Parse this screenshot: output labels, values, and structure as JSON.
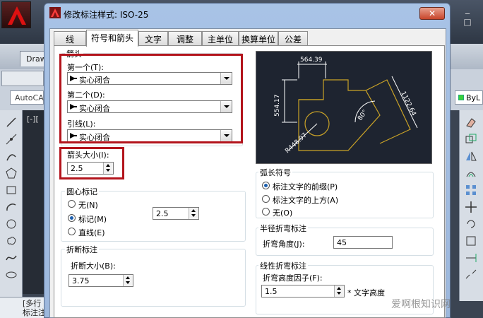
{
  "app": {
    "drawing_tab": "Draw",
    "left_combo": "AutoCA",
    "canvas_label": "[-][",
    "bylayer": "ByL",
    "command_lines": [
      "[多行",
      "标注注"
    ]
  },
  "dialog": {
    "title": "修改标注样式: ISO-25",
    "close_label": "✕"
  },
  "tabs": [
    {
      "label": "线",
      "active": false
    },
    {
      "label": "符号和箭头",
      "active": true
    },
    {
      "label": "文字",
      "active": false
    },
    {
      "label": "调整",
      "active": false
    },
    {
      "label": "主单位",
      "active": false
    },
    {
      "label": "换算单位",
      "active": false
    },
    {
      "label": "公差",
      "active": false
    }
  ],
  "arrows": {
    "group_label": "箭头",
    "first_label": "第一个(T):",
    "first_value": "实心闭合",
    "second_label": "第二个(D):",
    "second_value": "实心闭合",
    "leader_label": "引线(L):",
    "leader_value": "实心闭合",
    "size_label": "箭头大小(I):",
    "size_value": "2.5"
  },
  "center_mark": {
    "group_label": "圆心标记",
    "options": [
      "无(N)",
      "标记(M)",
      "直线(E)"
    ],
    "selected": 1,
    "size_value": "2.5"
  },
  "break": {
    "group_label": "折断标注",
    "size_label": "折断大小(B):",
    "size_value": "3.75"
  },
  "arc_length": {
    "group_label": "弧长符号",
    "options": [
      "标注文字的前缀(P)",
      "标注文字的上方(A)",
      "无(O)"
    ],
    "selected": 0
  },
  "radius_jog": {
    "group_label": "半径折弯标注",
    "angle_label": "折弯角度(J):",
    "angle_value": "45"
  },
  "linear_jog": {
    "group_label": "线性折弯标注",
    "factor_label": "折弯高度因子(F):",
    "factor_value": "1.5",
    "suffix": "* 文字高度"
  },
  "preview": {
    "dim_top": "564.39",
    "dim_left": "554.17",
    "dim_right": "1122.64",
    "dim_angle": "80°",
    "dim_radius": "R448.97"
  },
  "watermark": "爱啊根知识网",
  "colors": {
    "highlight_red": "#b3141c",
    "preview_bg": "#1e2430",
    "preview_line": "#c9a227",
    "preview_dim": "#ffffff",
    "radio_dot": "#1d5fae"
  }
}
